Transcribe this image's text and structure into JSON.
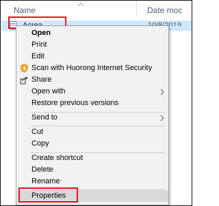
{
  "explorer": {
    "column_name": "Name",
    "column_date": "Date moc",
    "file": {
      "name": "Acrea",
      "date": "10/8/2019"
    }
  },
  "context_menu": {
    "items": [
      {
        "label": "Open",
        "bold": true
      },
      {
        "label": "Print"
      },
      {
        "label": "Edit"
      },
      {
        "label": "Scan with Huorong Internet Security",
        "icon": "huorong-shield-icon"
      },
      {
        "label": "Share",
        "icon": "share-icon"
      },
      {
        "label": "Open with",
        "submenu": true
      },
      {
        "label": "Restore previous versions"
      },
      {
        "label": "Send to",
        "submenu": true
      },
      {
        "label": "Cut"
      },
      {
        "label": "Copy"
      },
      {
        "label": "Create shortcut"
      },
      {
        "label": "Delete"
      },
      {
        "label": "Rename"
      },
      {
        "label": "Properties",
        "highlighted": true
      }
    ]
  },
  "colors": {
    "selection": "#cce8ff",
    "menu_background": "#f2f2f2",
    "annotation_red": "#e2151b",
    "menu_hover": "#d9d9d9"
  }
}
